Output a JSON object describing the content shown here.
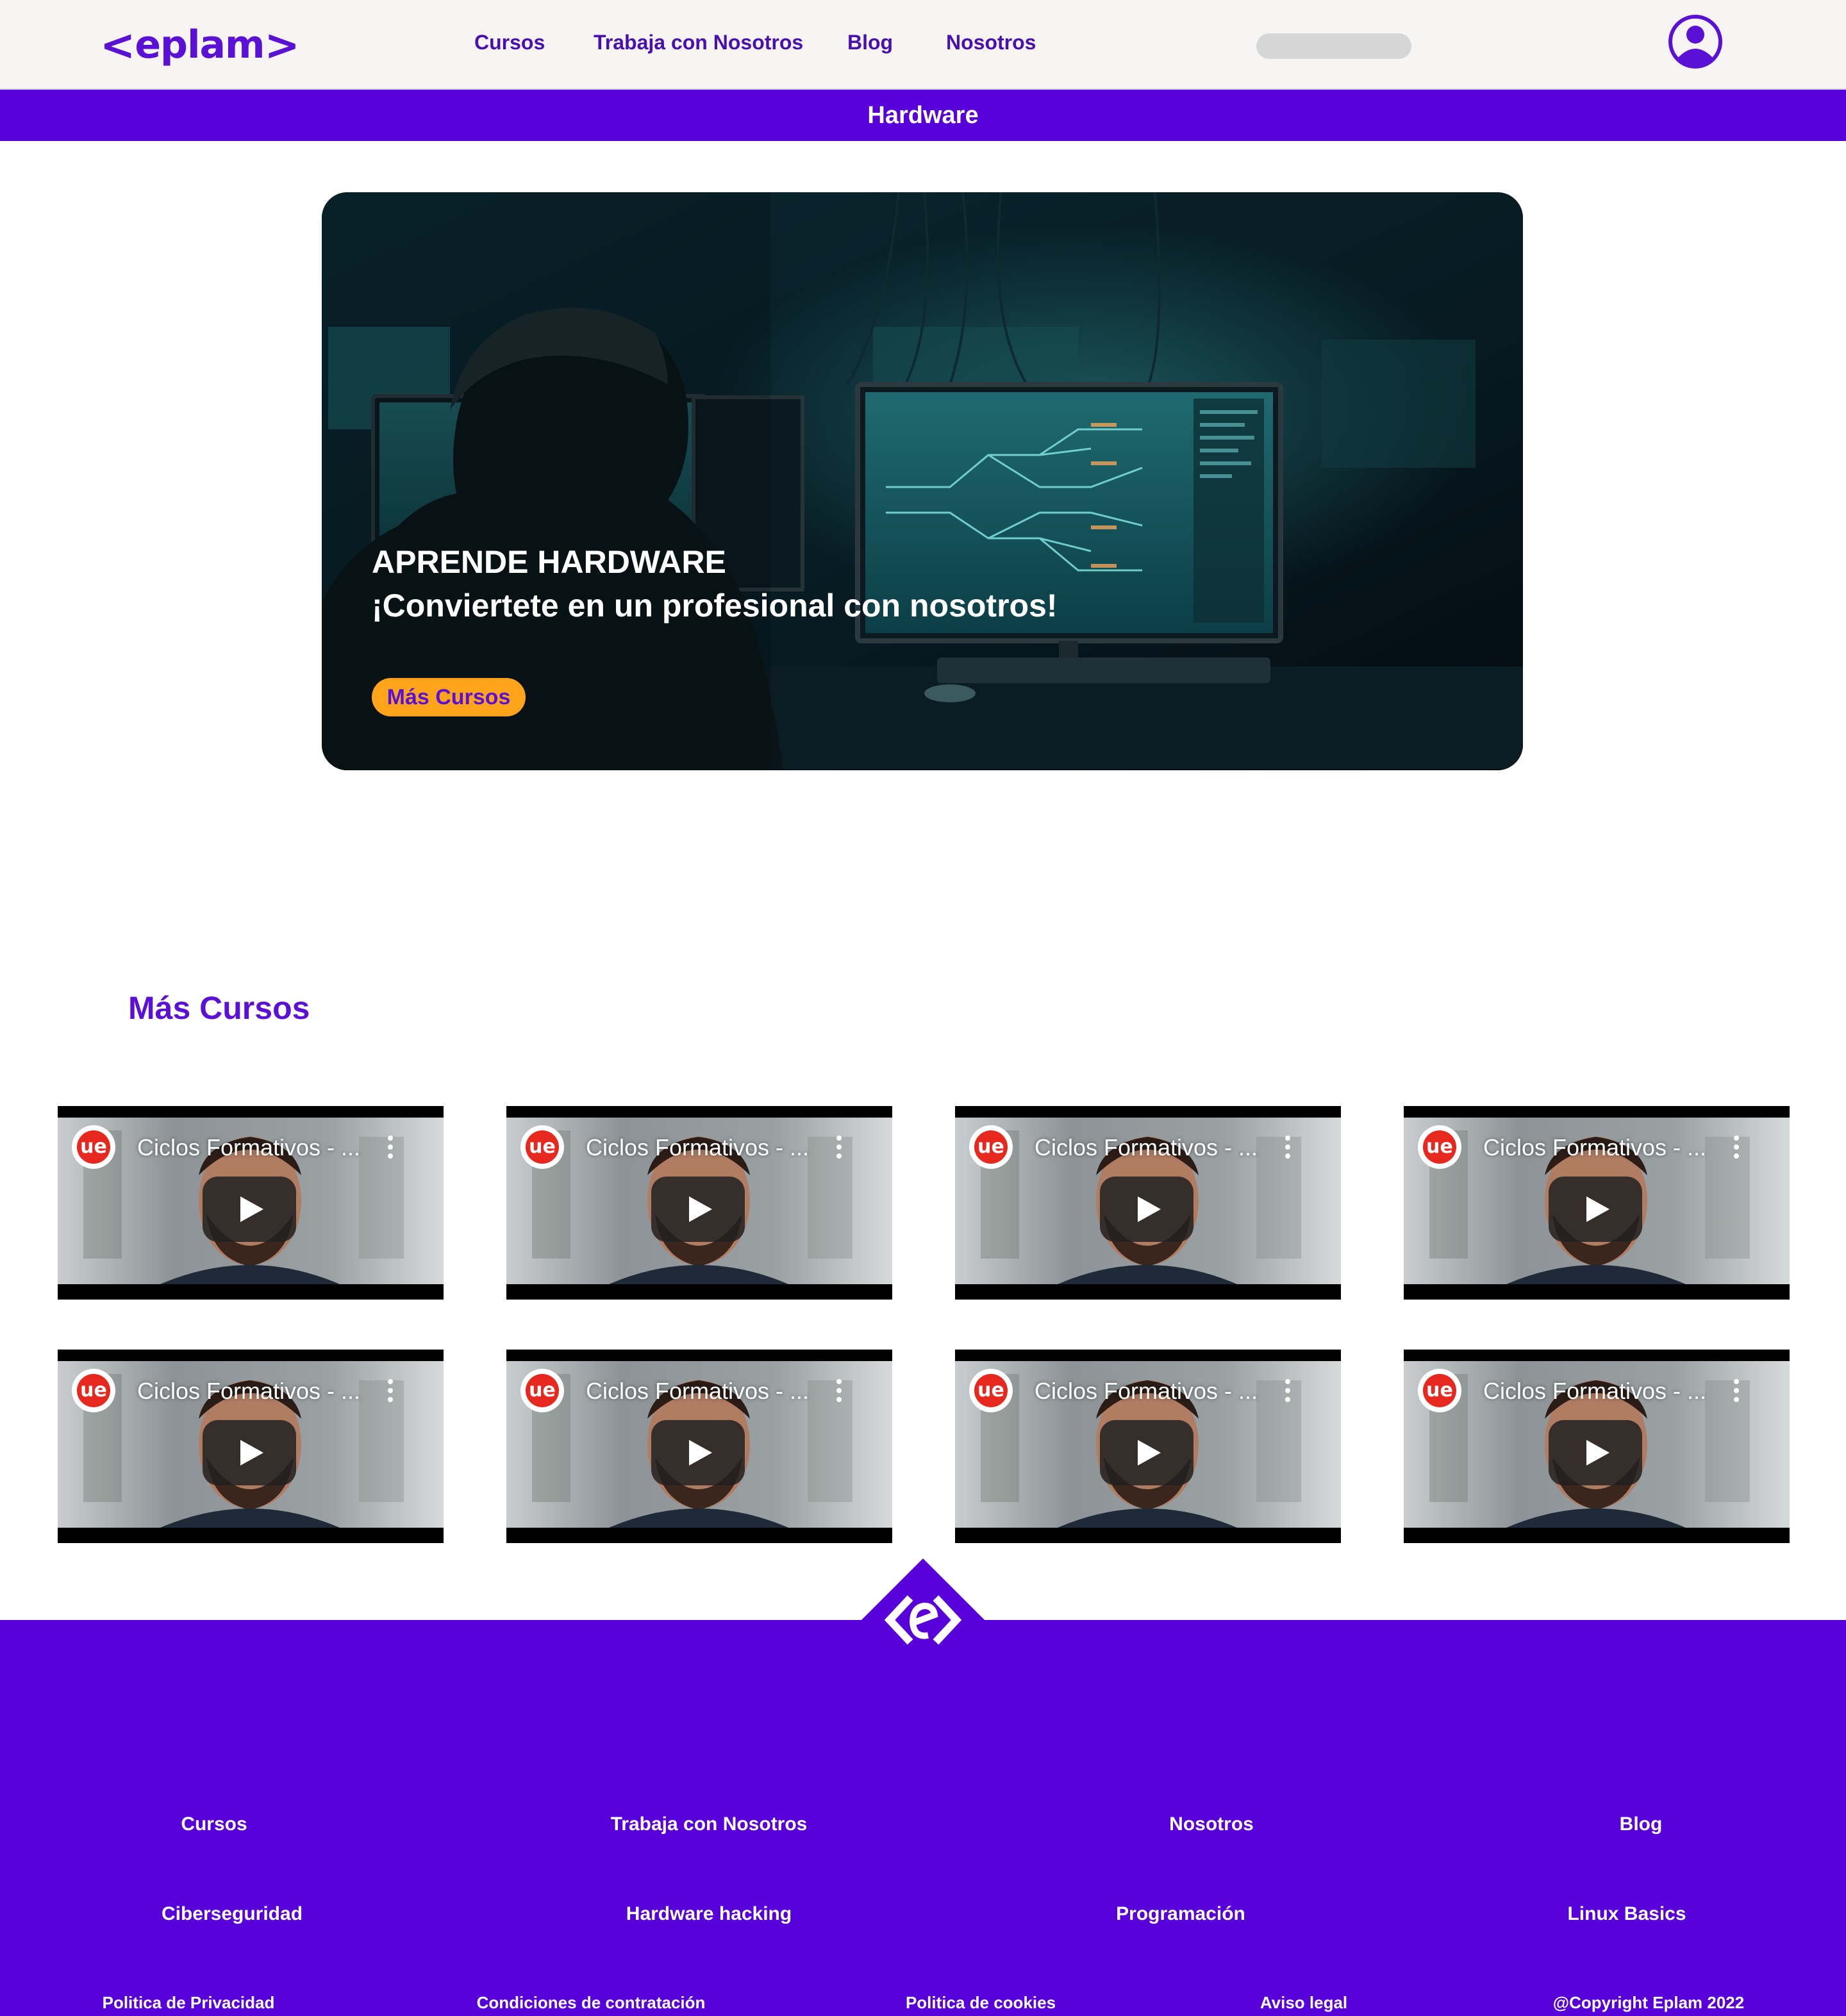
{
  "header": {
    "logo_text": "eplam",
    "nav": [
      "Cursos",
      "Trabaja con Nosotros",
      "Blog",
      "Nosotros"
    ],
    "search_placeholder": "",
    "user_icon": "user-icon"
  },
  "page_title": "Hardware",
  "hero": {
    "title": "APRENDE HARDWARE",
    "subtitle": "¡Conviertete en un profesional con nosotros!",
    "button": "Más Cursos"
  },
  "more_courses": {
    "heading": "Más Cursos",
    "videos": [
      {
        "title": "Ciclos Formativos - ...",
        "channel_badge": "ue"
      },
      {
        "title": "Ciclos Formativos - ...",
        "channel_badge": "ue"
      },
      {
        "title": "Ciclos Formativos - ...",
        "channel_badge": "ue"
      },
      {
        "title": "Ciclos Formativos - ...",
        "channel_badge": "ue"
      },
      {
        "title": "Ciclos Formativos - ...",
        "channel_badge": "ue"
      },
      {
        "title": "Ciclos Formativos - ...",
        "channel_badge": "ue"
      },
      {
        "title": "Ciclos Formativos - ...",
        "channel_badge": "ue"
      },
      {
        "title": "Ciclos Formativos - ...",
        "channel_badge": "ue"
      }
    ]
  },
  "footer": {
    "nav": [
      "Cursos",
      "Trabaja con Nosotros",
      "Nosotros",
      "Blog"
    ],
    "topics": [
      "Ciberseguridad",
      "Hardware hacking",
      "Programación",
      "Linux Basics"
    ],
    "legal": [
      "Politica de Privacidad",
      "Condiciones de contratación",
      "Politica de cookies",
      "Aviso legal"
    ],
    "copyright": "@Copyright Eplam 2022"
  },
  "colors": {
    "brand_purple": "#5800d9",
    "accent_orange": "#ffa41b",
    "header_bg": "#f6f5f3"
  }
}
